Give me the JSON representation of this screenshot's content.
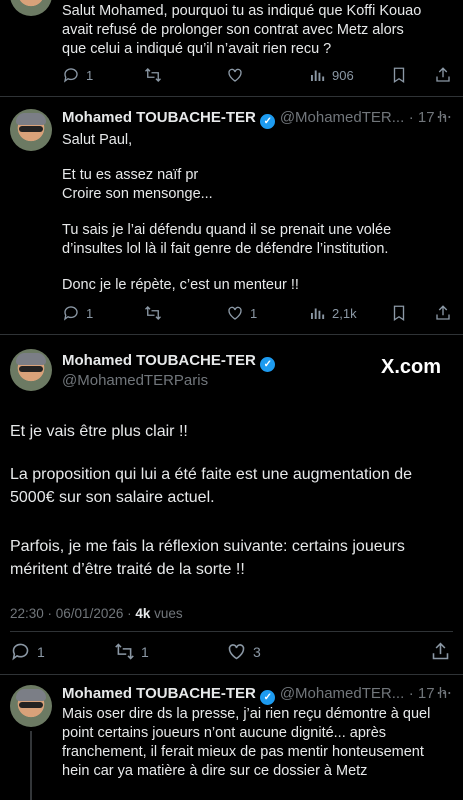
{
  "top_tweet": {
    "lines": [
      "Salut Mohamed, pourquoi tu as indiqué que Koffi Kouao",
      "avait refusé de prolonger son contrat avec Metz alors",
      "que celui a indiqué qu’il n’avait rien recu ?"
    ],
    "replies": "1",
    "views": "906"
  },
  "reply1": {
    "name": "Mohamed TOUBACHE-TER",
    "handle": "@MohamedTER...",
    "time": "· 17 h",
    "lines": [
      "Salut Paul,",
      "",
      "Et tu es assez naïf pr",
      "Croire son mensonge...",
      "",
      "Tu sais je l’ai défendu quand il se prenait une volée",
      "d’insultes lol là il fait genre de défendre l’institution.",
      "",
      "Donc je le répète, c’est un menteur !!"
    ],
    "replies": "1",
    "likes": "1",
    "views": "2,1k"
  },
  "main": {
    "name": "Mohamed TOUBACHE-TER",
    "handle": "@MohamedTERParis",
    "watermark": "X.com",
    "paragraphs": [
      [
        "Et je vais être plus clair !!"
      ],
      [
        "La proposition qui lui a été faite est une augmentation de",
        "5000€ sur son salaire actuel."
      ],
      [
        "Parfois, je me fais la réflexion suivante: certains joueurs",
        "méritent d’être traité de la sorte !!"
      ]
    ],
    "timestamp": "22:30 · 06/01/2026 · ",
    "views_count": "4k",
    "views_label": " vues",
    "replies": "1",
    "reposts": "1",
    "likes": "3"
  },
  "reply2": {
    "name": "Mohamed TOUBACHE-TER",
    "handle": "@MohamedTER...",
    "time": "· 17 h",
    "lines": [
      "Mais oser dire ds la presse, j’ai rien reçu démontre à quel",
      "point certains joueurs n’ont aucune dignité... après",
      "franchement, il ferait mieux de pas mentir honteusement",
      "hein car ya matière à dire sur ce dossier à Metz"
    ]
  },
  "colors": {
    "background": "#000000",
    "text": "#e7e9ea",
    "muted": "#71767b",
    "verified": "#1d9bf0"
  }
}
